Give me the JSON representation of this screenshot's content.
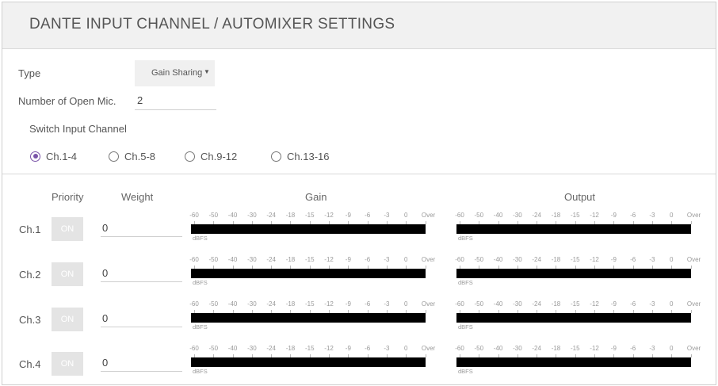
{
  "header": {
    "title": "DANTE INPUT CHANNEL / AUTOMIXER SETTINGS"
  },
  "type": {
    "label": "Type",
    "value": "Gain Sharing"
  },
  "open_mic": {
    "label": "Number of Open Mic.",
    "value": "2"
  },
  "switch_input": {
    "label": "Switch Input Channel",
    "options": [
      "Ch.1-4",
      "Ch.5-8",
      "Ch.9-12",
      "Ch.13-16"
    ],
    "selected": "Ch.1-4"
  },
  "columns": {
    "priority": "Priority",
    "weight": "Weight",
    "gain": "Gain",
    "output": "Output"
  },
  "meter": {
    "scale": [
      "-60",
      "-50",
      "-40",
      "-30",
      "-24",
      "-18",
      "-15",
      "-12",
      "-9",
      "-6",
      "-3",
      "0",
      "Over"
    ],
    "unit": "dBFS"
  },
  "channels": [
    {
      "name": "Ch.1",
      "priority": "ON",
      "weight": "0"
    },
    {
      "name": "Ch.2",
      "priority": "ON",
      "weight": "0"
    },
    {
      "name": "Ch.3",
      "priority": "ON",
      "weight": "0"
    },
    {
      "name": "Ch.4",
      "priority": "ON",
      "weight": "0"
    }
  ],
  "colors": {
    "accent": "#7a54a8",
    "meter_bar": "#000000",
    "header_bg": "#f1f1f1"
  }
}
